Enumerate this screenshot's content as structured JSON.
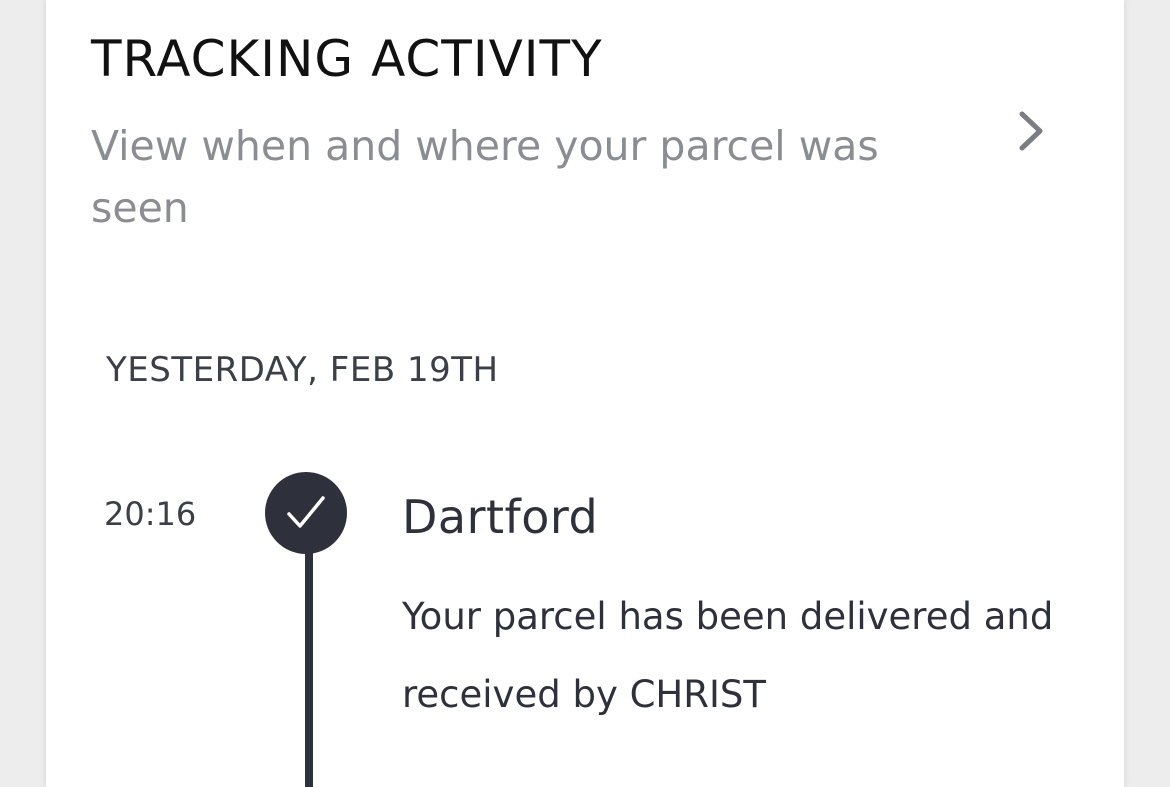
{
  "tracking": {
    "title": "TRACKING ACTIVITY",
    "subtitle": "View when and where your parcel was seen",
    "chevron_icon": "chevron-right-icon"
  },
  "activity": {
    "date_header": "YESTERDAY, FEB 19TH",
    "events": [
      {
        "time": "20:16",
        "status_icon": "check-icon",
        "location": "Dartford",
        "description": "Your parcel has been delivered and received by CHRIST"
      }
    ]
  },
  "colors": {
    "accent_dark": "#2e313b",
    "subtitle_gray": "#8a8d91"
  }
}
